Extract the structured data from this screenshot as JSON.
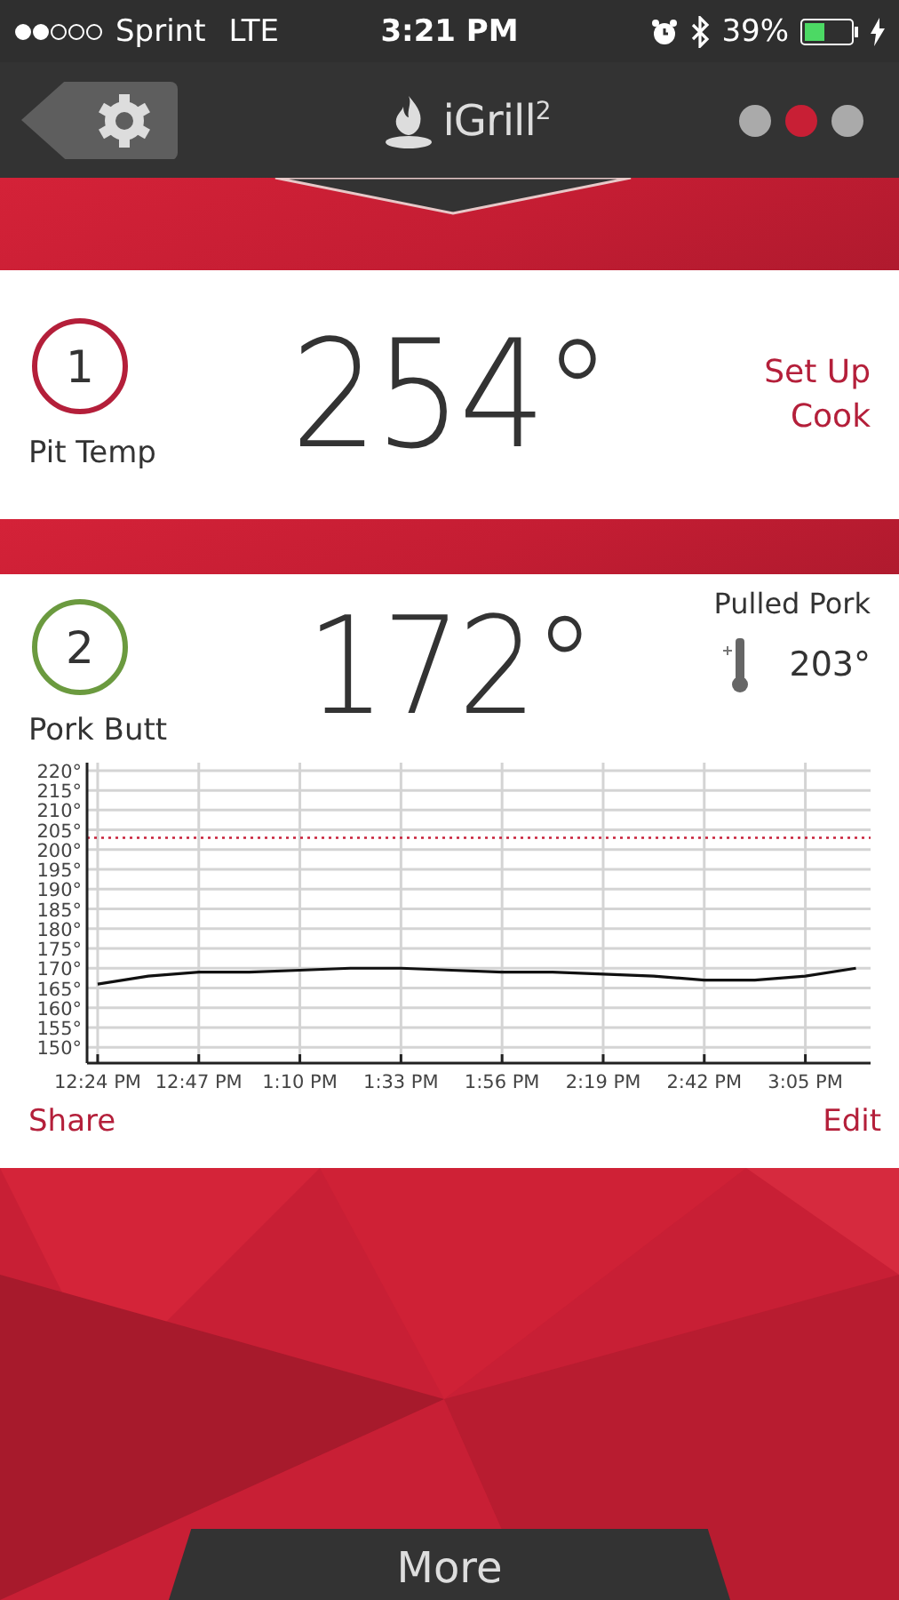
{
  "status_bar": {
    "carrier": "Sprint",
    "network": "LTE",
    "time": "3:21 PM",
    "battery": "39%"
  },
  "header": {
    "logo": "iGrill$^{2}$",
    "pages": [
      {
        "selected": false
      },
      {
        "selected": true
      },
      {
        "selected": false
      }
    ]
  },
  "probes": [
    {
      "number": "1",
      "color": "#b41f3a",
      "name": "Pit Temp",
      "temperature": "254°",
      "action": "Set Up Cook"
    },
    {
      "number": "2",
      "color": "#6b9a3f",
      "name": "Pork Butt",
      "temperature": "172°",
      "preset": "Pulled Pork",
      "target": "203°",
      "chart_data": {
        "type": "line",
        "categories": [
          "12:24 PM",
          null,
          "12:47 PM",
          null,
          "1:10 PM",
          null,
          "1:33 PM",
          null,
          "1:56 PM",
          null,
          "2:19 PM",
          null,
          "2:42 PM",
          null,
          "3:05 PM",
          null
        ],
        "series": [
          {
            "color": "#111111",
            "values": [
              166,
              168,
              169,
              169,
              169.5,
              170,
              170,
              169.5,
              169,
              169,
              168.5,
              168,
              167,
              167,
              168,
              170
            ]
          }
        ],
        "ylim": [
          146,
          222
        ],
        "yticks": [
          {
            "value": 150,
            "label": "150°"
          },
          {
            "value": 155,
            "label": "155°"
          },
          {
            "value": 160,
            "label": "160°"
          },
          {
            "value": 165,
            "label": "165°"
          },
          {
            "value": 170,
            "label": "170°"
          },
          {
            "value": 175,
            "label": "175°"
          },
          {
            "value": 180,
            "label": "180°"
          },
          {
            "value": 185,
            "label": "185°"
          },
          {
            "value": 190,
            "label": "190°"
          },
          {
            "value": 195,
            "label": "195°"
          },
          {
            "value": 200,
            "label": "200°"
          },
          {
            "value": 205,
            "label": "205°"
          },
          {
            "value": 210,
            "label": "210°"
          },
          {
            "value": 215,
            "label": "215°"
          },
          {
            "value": 220,
            "label": "220°"
          }
        ],
        "grid": true,
        "ref_lines": [
          {
            "axis": "y",
            "value": 203,
            "color": "#c8203a"
          }
        ]
      },
      "share": "Share",
      "edit": "Edit"
    }
  ],
  "footer": {
    "label": "More"
  }
}
